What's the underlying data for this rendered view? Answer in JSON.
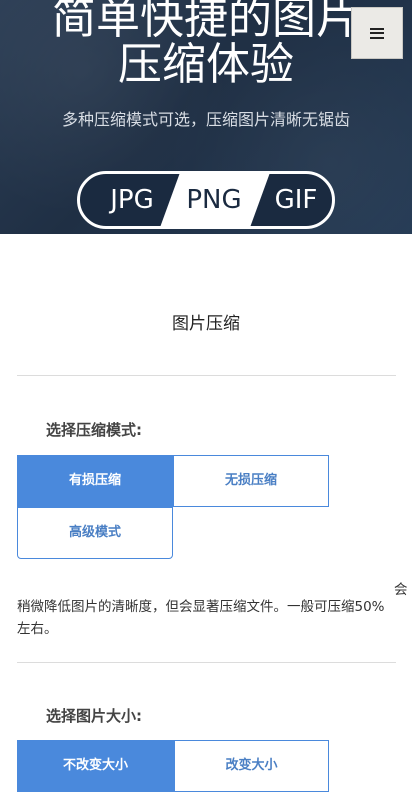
{
  "hero": {
    "title_line1": "简单快捷的图片",
    "title_line2": "压缩体验",
    "subtitle": "多种压缩模式可选，压缩图片清晰无锯齿",
    "formats": [
      "JPG",
      "PNG",
      "GIF"
    ],
    "active_format": "PNG"
  },
  "menu": {
    "icon": "hamburger-menu-icon"
  },
  "main": {
    "section_title": "图片压缩",
    "mode": {
      "label": "选择压缩模式:",
      "options": [
        "有损压缩",
        "无损压缩",
        "高级模式"
      ],
      "selected": "有损压缩",
      "description": "稍微降低图片的清晰度，但会显著压缩文件。一般可压缩50%左右。",
      "side_char": "会"
    },
    "size": {
      "label": "选择图片大小:",
      "options": [
        "不改变大小",
        "改变大小"
      ],
      "selected": "不改变大小"
    }
  },
  "colors": {
    "accent": "#4a89dc",
    "hero_bg": "#1f2f44"
  }
}
